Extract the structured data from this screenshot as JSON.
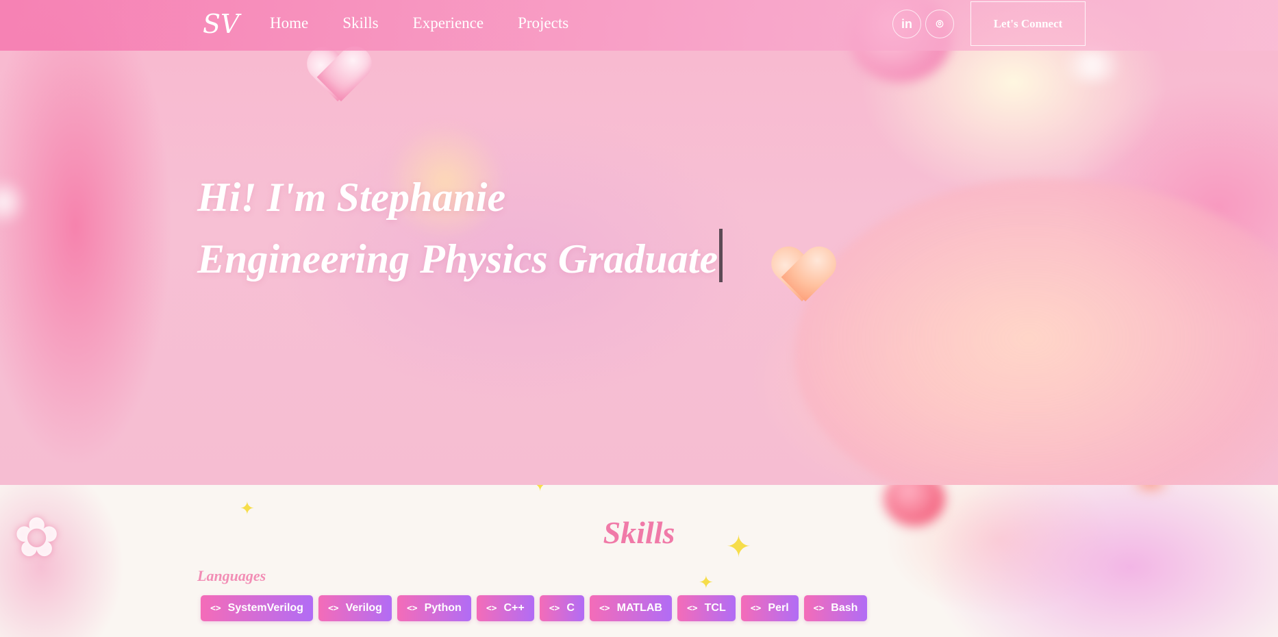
{
  "navbar": {
    "logo": "SV",
    "links": [
      "Home",
      "Skills",
      "Experience",
      "Projects"
    ],
    "social": {
      "linkedin_glyph": "in",
      "github_glyph": "⌾"
    },
    "connect_label": "Let's Connect"
  },
  "hero": {
    "greeting": "Hi! I'm Stephanie",
    "subtitle": "Engineering Physics Graduate"
  },
  "skills": {
    "title": "Skills",
    "languages_label": "Languages",
    "chip_icon": "<>",
    "languages": [
      "SystemVerilog",
      "Verilog",
      "Python",
      "C++",
      "C",
      "MATLAB",
      "TCL",
      "Perl",
      "Bash"
    ]
  },
  "colors": {
    "accent_pink": "#f07aa8",
    "chip_gradient_start": "#f46cb8",
    "chip_gradient_end": "#b16cf5"
  }
}
